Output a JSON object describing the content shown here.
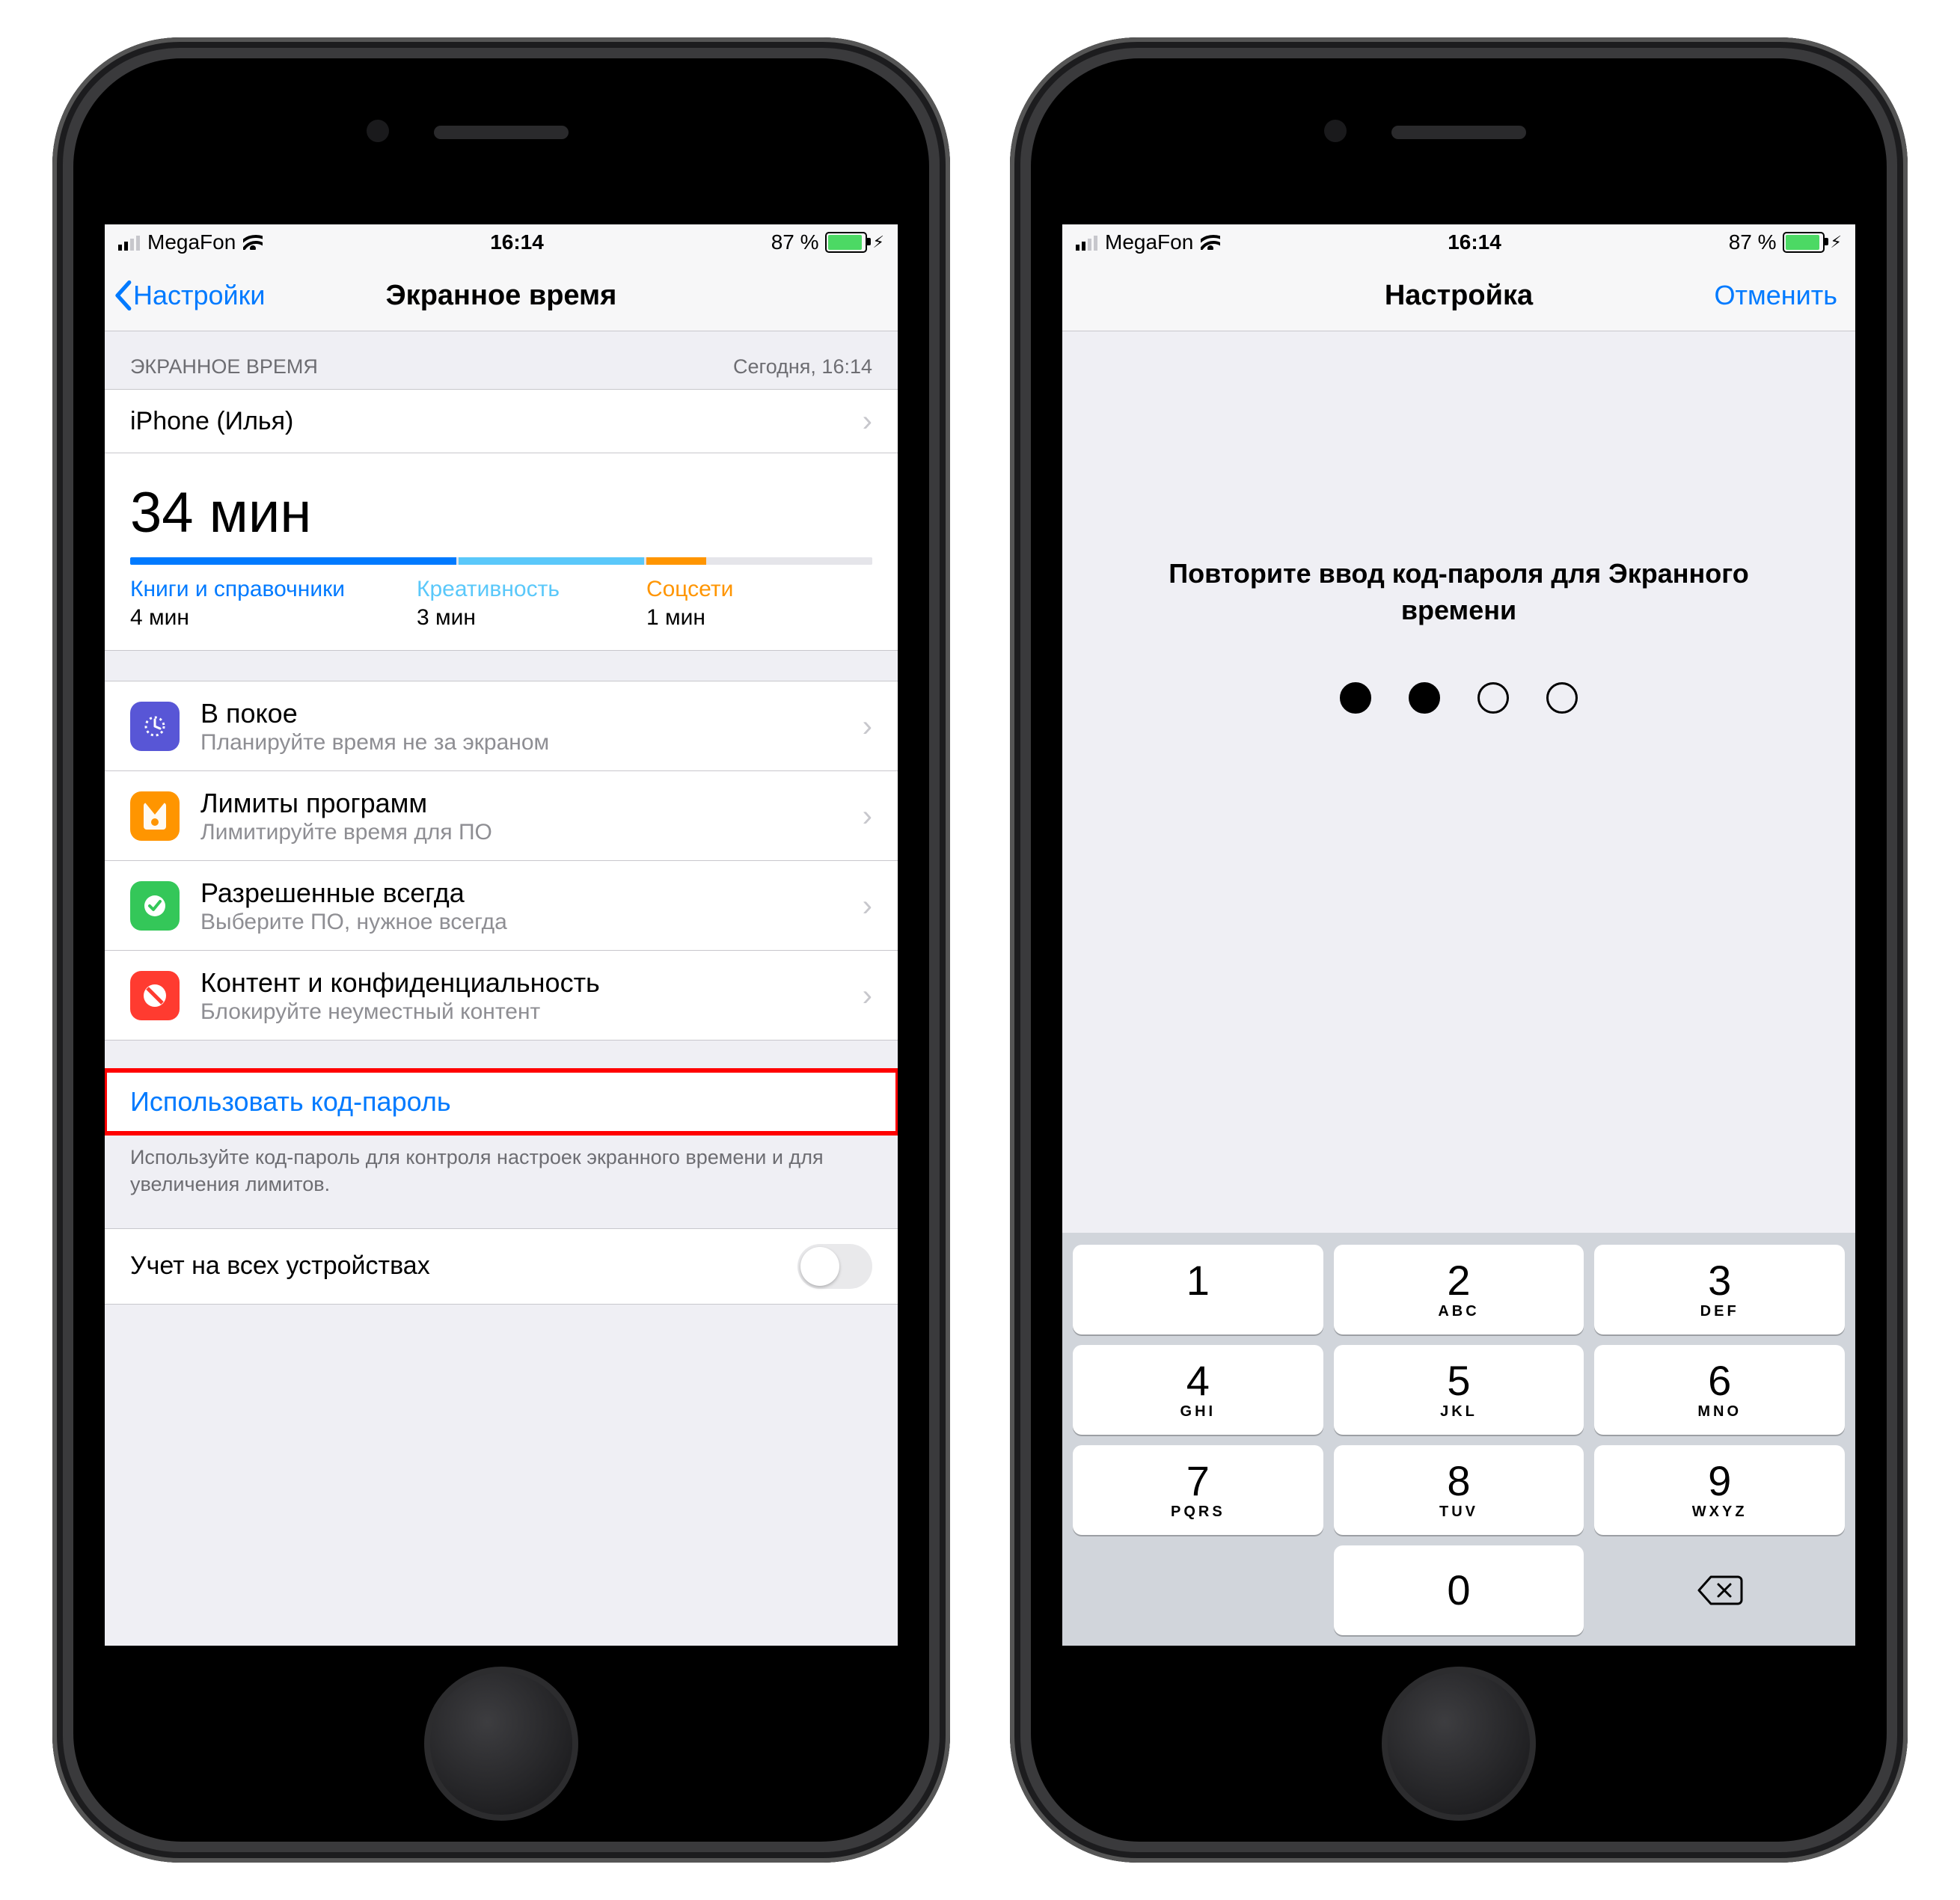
{
  "status": {
    "carrier": "MegaFon",
    "time": "16:14",
    "battery_pct": "87 %",
    "battery_fill_pct": 87
  },
  "left": {
    "nav": {
      "back": "Настройки",
      "title": "Экранное время"
    },
    "section_header": {
      "left": "ЭКРАННОЕ ВРЕМЯ",
      "right": "Сегодня, 16:14"
    },
    "device_name": "iPhone (Илья)",
    "total": "34 мин",
    "bars": [
      {
        "pct": 44,
        "color": "#007aff"
      },
      {
        "pct": 25,
        "color": "#5ac8fa"
      },
      {
        "pct": 8,
        "color": "#ff9500"
      }
    ],
    "categories": [
      {
        "label": "Книги и справочники",
        "time": "4 мин",
        "color": "#007aff"
      },
      {
        "label": "Креативность",
        "time": "3 мин",
        "color": "#5ac8fa"
      },
      {
        "label": "Соцсети",
        "time": "1 мин",
        "color": "#ff9500"
      }
    ],
    "rows": [
      {
        "title": "В покое",
        "subtitle": "Планируйте время не за экраном",
        "icon_bg": "#5856d6"
      },
      {
        "title": "Лимиты программ",
        "subtitle": "Лимитируйте время для ПО",
        "icon_bg": "#ff9500"
      },
      {
        "title": "Разрешенные всегда",
        "subtitle": "Выберите ПО, нужное всегда",
        "icon_bg": "#34c759"
      },
      {
        "title": "Контент и конфиденциальность",
        "subtitle": "Блокируйте неуместный контент",
        "icon_bg": "#ff3b30"
      }
    ],
    "passcode_action": "Использовать код-пароль",
    "passcode_footer": "Используйте код-пароль для контроля настроек экранного времени и для увеличения лимитов.",
    "sync_row": "Учет на всех устройствах"
  },
  "right": {
    "nav": {
      "title": "Настройка",
      "cancel": "Отменить"
    },
    "prompt": "Повторите ввод код-пароля для Экранного времени",
    "dots_filled": 2,
    "keypad": [
      {
        "n": "1",
        "l": ""
      },
      {
        "n": "2",
        "l": "ABC"
      },
      {
        "n": "3",
        "l": "DEF"
      },
      {
        "n": "4",
        "l": "GHI"
      },
      {
        "n": "5",
        "l": "JKL"
      },
      {
        "n": "6",
        "l": "MNO"
      },
      {
        "n": "7",
        "l": "PQRS"
      },
      {
        "n": "8",
        "l": "TUV"
      },
      {
        "n": "9",
        "l": "WXYZ"
      },
      {
        "n": "0",
        "l": ""
      }
    ]
  }
}
